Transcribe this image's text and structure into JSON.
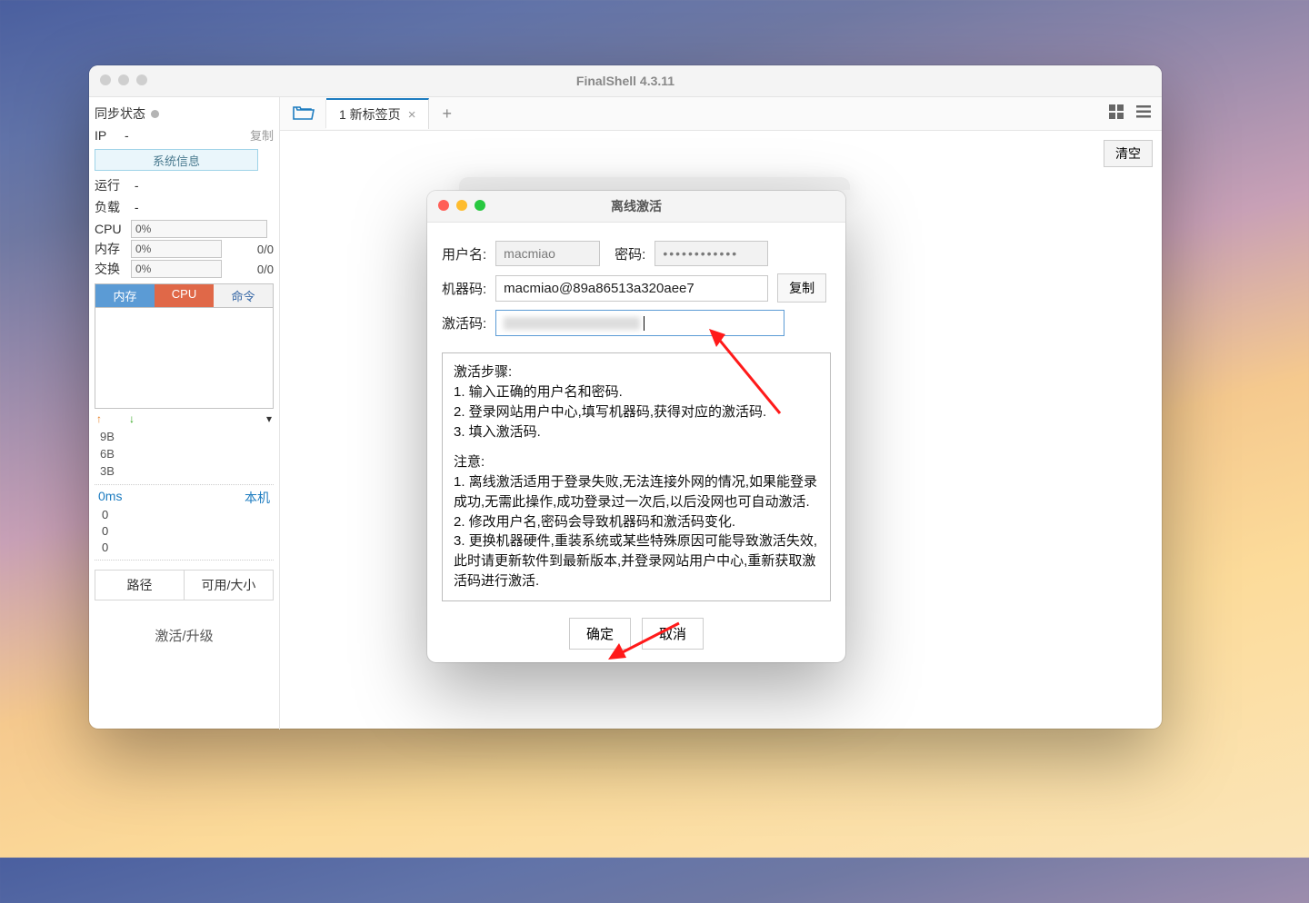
{
  "window": {
    "title": "FinalShell 4.3.11"
  },
  "sidebar": {
    "sync_label": "同步状态",
    "ip_label": "IP",
    "ip_value": "-",
    "copy_label": "复制",
    "sysinfo_btn": "系统信息",
    "run_label": "运行",
    "run_value": "-",
    "load_label": "负载",
    "load_value": "-",
    "cpu_label": "CPU",
    "cpu_value": "0%",
    "mem_label": "内存",
    "mem_value": "0%",
    "mem_extra": "0/0",
    "swap_label": "交换",
    "swap_value": "0%",
    "swap_extra": "0/0",
    "tabs": {
      "mem": "内存",
      "cpu": "CPU",
      "cmd": "命令"
    },
    "bytes": [
      "9B",
      "6B",
      "3B"
    ],
    "ms_label": "0ms",
    "local_label": "本机",
    "zeros": [
      "0",
      "0",
      "0"
    ],
    "path_col": "路径",
    "size_col": "可用/大小",
    "activate_link": "激活/升级"
  },
  "toolbar": {
    "tab_label": "1 新标签页",
    "clear_btn": "清空"
  },
  "dialog": {
    "title": "离线激活",
    "username_label": "用户名:",
    "username_value": "macmiao",
    "password_label": "密码:",
    "password_value": "••••••••••••",
    "machine_label": "机器码:",
    "machine_value": "macmiao@89a86513a320aee7",
    "copy_btn": "复制",
    "code_label": "激活码:",
    "steps_heading": "激活步骤:",
    "steps": [
      "1. 输入正确的用户名和密码.",
      "2. 登录网站用户中心,填写机器码,获得对应的激活码.",
      "3. 填入激活码."
    ],
    "notes_heading": "注意:",
    "notes": [
      "1. 离线激活适用于登录失败,无法连接外网的情况,如果能登录成功,无需此操作,成功登录过一次后,以后没网也可自动激活.",
      "2. 修改用户名,密码会导致机器码和激活码变化.",
      "3. 更换机器硬件,重装系统或某些特殊原因可能导致激活失效,此时请更新软件到最新版本,并登录网站用户中心,重新获取激活码进行激活."
    ],
    "ok_btn": "确定",
    "cancel_btn": "取消"
  }
}
